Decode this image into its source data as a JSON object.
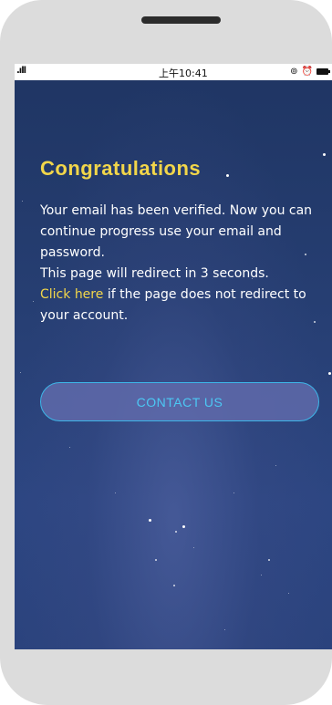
{
  "status_bar": {
    "signal": "‧‧∧∧",
    "time": "上午10:41"
  },
  "page": {
    "title": "Congratulations",
    "body_1": "Your email has been verified. Now you can continue progress use your email and password.",
    "body_2": "This page will redirect in 3 seconds.",
    "link_click": "Click",
    "link_here": "here",
    "body_3": " if the page does not redirect to your account.",
    "contact_button_label": "CONTACT US"
  },
  "colors": {
    "accent_yellow": "#f2d64a",
    "button_border": "#3db6e8",
    "background_top": "#1f3563",
    "background_bottom": "#2d4682"
  }
}
